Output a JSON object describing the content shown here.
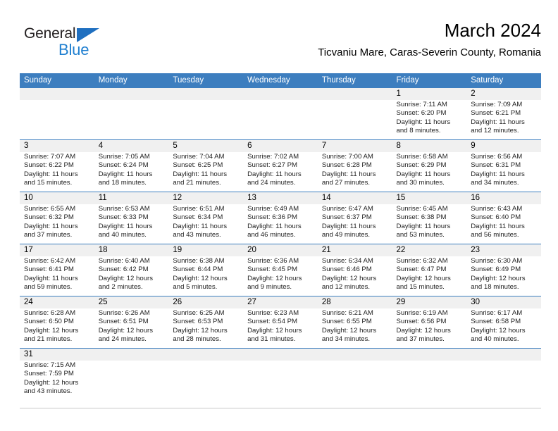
{
  "header": {
    "logo": {
      "word_one": "General",
      "word_two": "Blue",
      "triangle_icon": "triangle-icon"
    },
    "month_title": "March 2024",
    "location": "Ticvaniu Mare, Caras-Severin County, Romania"
  },
  "calendar": {
    "weekdays": [
      "Sunday",
      "Monday",
      "Tuesday",
      "Wednesday",
      "Thursday",
      "Friday",
      "Saturday"
    ],
    "accent_color": "#3d7ebf",
    "daynum_band_color": "#f0f0f0",
    "weeks": [
      [
        {
          "day": "",
          "sunrise": "",
          "sunset": "",
          "daylight_1": "",
          "daylight_2": ""
        },
        {
          "day": "",
          "sunrise": "",
          "sunset": "",
          "daylight_1": "",
          "daylight_2": ""
        },
        {
          "day": "",
          "sunrise": "",
          "sunset": "",
          "daylight_1": "",
          "daylight_2": ""
        },
        {
          "day": "",
          "sunrise": "",
          "sunset": "",
          "daylight_1": "",
          "daylight_2": ""
        },
        {
          "day": "",
          "sunrise": "",
          "sunset": "",
          "daylight_1": "",
          "daylight_2": ""
        },
        {
          "day": "1",
          "sunrise": "Sunrise: 7:11 AM",
          "sunset": "Sunset: 6:20 PM",
          "daylight_1": "Daylight: 11 hours",
          "daylight_2": "and 8 minutes."
        },
        {
          "day": "2",
          "sunrise": "Sunrise: 7:09 AM",
          "sunset": "Sunset: 6:21 PM",
          "daylight_1": "Daylight: 11 hours",
          "daylight_2": "and 12 minutes."
        }
      ],
      [
        {
          "day": "3",
          "sunrise": "Sunrise: 7:07 AM",
          "sunset": "Sunset: 6:22 PM",
          "daylight_1": "Daylight: 11 hours",
          "daylight_2": "and 15 minutes."
        },
        {
          "day": "4",
          "sunrise": "Sunrise: 7:05 AM",
          "sunset": "Sunset: 6:24 PM",
          "daylight_1": "Daylight: 11 hours",
          "daylight_2": "and 18 minutes."
        },
        {
          "day": "5",
          "sunrise": "Sunrise: 7:04 AM",
          "sunset": "Sunset: 6:25 PM",
          "daylight_1": "Daylight: 11 hours",
          "daylight_2": "and 21 minutes."
        },
        {
          "day": "6",
          "sunrise": "Sunrise: 7:02 AM",
          "sunset": "Sunset: 6:27 PM",
          "daylight_1": "Daylight: 11 hours",
          "daylight_2": "and 24 minutes."
        },
        {
          "day": "7",
          "sunrise": "Sunrise: 7:00 AM",
          "sunset": "Sunset: 6:28 PM",
          "daylight_1": "Daylight: 11 hours",
          "daylight_2": "and 27 minutes."
        },
        {
          "day": "8",
          "sunrise": "Sunrise: 6:58 AM",
          "sunset": "Sunset: 6:29 PM",
          "daylight_1": "Daylight: 11 hours",
          "daylight_2": "and 30 minutes."
        },
        {
          "day": "9",
          "sunrise": "Sunrise: 6:56 AM",
          "sunset": "Sunset: 6:31 PM",
          "daylight_1": "Daylight: 11 hours",
          "daylight_2": "and 34 minutes."
        }
      ],
      [
        {
          "day": "10",
          "sunrise": "Sunrise: 6:55 AM",
          "sunset": "Sunset: 6:32 PM",
          "daylight_1": "Daylight: 11 hours",
          "daylight_2": "and 37 minutes."
        },
        {
          "day": "11",
          "sunrise": "Sunrise: 6:53 AM",
          "sunset": "Sunset: 6:33 PM",
          "daylight_1": "Daylight: 11 hours",
          "daylight_2": "and 40 minutes."
        },
        {
          "day": "12",
          "sunrise": "Sunrise: 6:51 AM",
          "sunset": "Sunset: 6:34 PM",
          "daylight_1": "Daylight: 11 hours",
          "daylight_2": "and 43 minutes."
        },
        {
          "day": "13",
          "sunrise": "Sunrise: 6:49 AM",
          "sunset": "Sunset: 6:36 PM",
          "daylight_1": "Daylight: 11 hours",
          "daylight_2": "and 46 minutes."
        },
        {
          "day": "14",
          "sunrise": "Sunrise: 6:47 AM",
          "sunset": "Sunset: 6:37 PM",
          "daylight_1": "Daylight: 11 hours",
          "daylight_2": "and 49 minutes."
        },
        {
          "day": "15",
          "sunrise": "Sunrise: 6:45 AM",
          "sunset": "Sunset: 6:38 PM",
          "daylight_1": "Daylight: 11 hours",
          "daylight_2": "and 53 minutes."
        },
        {
          "day": "16",
          "sunrise": "Sunrise: 6:43 AM",
          "sunset": "Sunset: 6:40 PM",
          "daylight_1": "Daylight: 11 hours",
          "daylight_2": "and 56 minutes."
        }
      ],
      [
        {
          "day": "17",
          "sunrise": "Sunrise: 6:42 AM",
          "sunset": "Sunset: 6:41 PM",
          "daylight_1": "Daylight: 11 hours",
          "daylight_2": "and 59 minutes."
        },
        {
          "day": "18",
          "sunrise": "Sunrise: 6:40 AM",
          "sunset": "Sunset: 6:42 PM",
          "daylight_1": "Daylight: 12 hours",
          "daylight_2": "and 2 minutes."
        },
        {
          "day": "19",
          "sunrise": "Sunrise: 6:38 AM",
          "sunset": "Sunset: 6:44 PM",
          "daylight_1": "Daylight: 12 hours",
          "daylight_2": "and 5 minutes."
        },
        {
          "day": "20",
          "sunrise": "Sunrise: 6:36 AM",
          "sunset": "Sunset: 6:45 PM",
          "daylight_1": "Daylight: 12 hours",
          "daylight_2": "and 9 minutes."
        },
        {
          "day": "21",
          "sunrise": "Sunrise: 6:34 AM",
          "sunset": "Sunset: 6:46 PM",
          "daylight_1": "Daylight: 12 hours",
          "daylight_2": "and 12 minutes."
        },
        {
          "day": "22",
          "sunrise": "Sunrise: 6:32 AM",
          "sunset": "Sunset: 6:47 PM",
          "daylight_1": "Daylight: 12 hours",
          "daylight_2": "and 15 minutes."
        },
        {
          "day": "23",
          "sunrise": "Sunrise: 6:30 AM",
          "sunset": "Sunset: 6:49 PM",
          "daylight_1": "Daylight: 12 hours",
          "daylight_2": "and 18 minutes."
        }
      ],
      [
        {
          "day": "24",
          "sunrise": "Sunrise: 6:28 AM",
          "sunset": "Sunset: 6:50 PM",
          "daylight_1": "Daylight: 12 hours",
          "daylight_2": "and 21 minutes."
        },
        {
          "day": "25",
          "sunrise": "Sunrise: 6:26 AM",
          "sunset": "Sunset: 6:51 PM",
          "daylight_1": "Daylight: 12 hours",
          "daylight_2": "and 24 minutes."
        },
        {
          "day": "26",
          "sunrise": "Sunrise: 6:25 AM",
          "sunset": "Sunset: 6:53 PM",
          "daylight_1": "Daylight: 12 hours",
          "daylight_2": "and 28 minutes."
        },
        {
          "day": "27",
          "sunrise": "Sunrise: 6:23 AM",
          "sunset": "Sunset: 6:54 PM",
          "daylight_1": "Daylight: 12 hours",
          "daylight_2": "and 31 minutes."
        },
        {
          "day": "28",
          "sunrise": "Sunrise: 6:21 AM",
          "sunset": "Sunset: 6:55 PM",
          "daylight_1": "Daylight: 12 hours",
          "daylight_2": "and 34 minutes."
        },
        {
          "day": "29",
          "sunrise": "Sunrise: 6:19 AM",
          "sunset": "Sunset: 6:56 PM",
          "daylight_1": "Daylight: 12 hours",
          "daylight_2": "and 37 minutes."
        },
        {
          "day": "30",
          "sunrise": "Sunrise: 6:17 AM",
          "sunset": "Sunset: 6:58 PM",
          "daylight_1": "Daylight: 12 hours",
          "daylight_2": "and 40 minutes."
        }
      ],
      [
        {
          "day": "31",
          "sunrise": "Sunrise: 7:15 AM",
          "sunset": "Sunset: 7:59 PM",
          "daylight_1": "Daylight: 12 hours",
          "daylight_2": "and 43 minutes."
        },
        {
          "day": "",
          "sunrise": "",
          "sunset": "",
          "daylight_1": "",
          "daylight_2": ""
        },
        {
          "day": "",
          "sunrise": "",
          "sunset": "",
          "daylight_1": "",
          "daylight_2": ""
        },
        {
          "day": "",
          "sunrise": "",
          "sunset": "",
          "daylight_1": "",
          "daylight_2": ""
        },
        {
          "day": "",
          "sunrise": "",
          "sunset": "",
          "daylight_1": "",
          "daylight_2": ""
        },
        {
          "day": "",
          "sunrise": "",
          "sunset": "",
          "daylight_1": "",
          "daylight_2": ""
        },
        {
          "day": "",
          "sunrise": "",
          "sunset": "",
          "daylight_1": "",
          "daylight_2": ""
        }
      ]
    ]
  }
}
